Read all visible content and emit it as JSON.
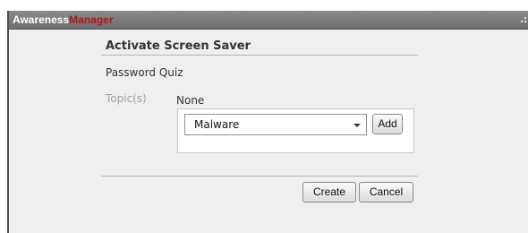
{
  "app": {
    "brand_prefix": "Awareness",
    "brand_suffix": "Manager"
  },
  "dialog": {
    "title": "Activate Screen Saver",
    "quiz_name": "Password Quiz",
    "topics_label": "Topic(s)",
    "topics_value": "None",
    "topic_select": {
      "selected": "Malware"
    },
    "add_label": "Add",
    "create_label": "Create",
    "cancel_label": "Cancel"
  },
  "colors": {
    "title_bar": "#7c7c7c",
    "brand_accent": "#b4121b",
    "panel_background": "#efefef"
  }
}
